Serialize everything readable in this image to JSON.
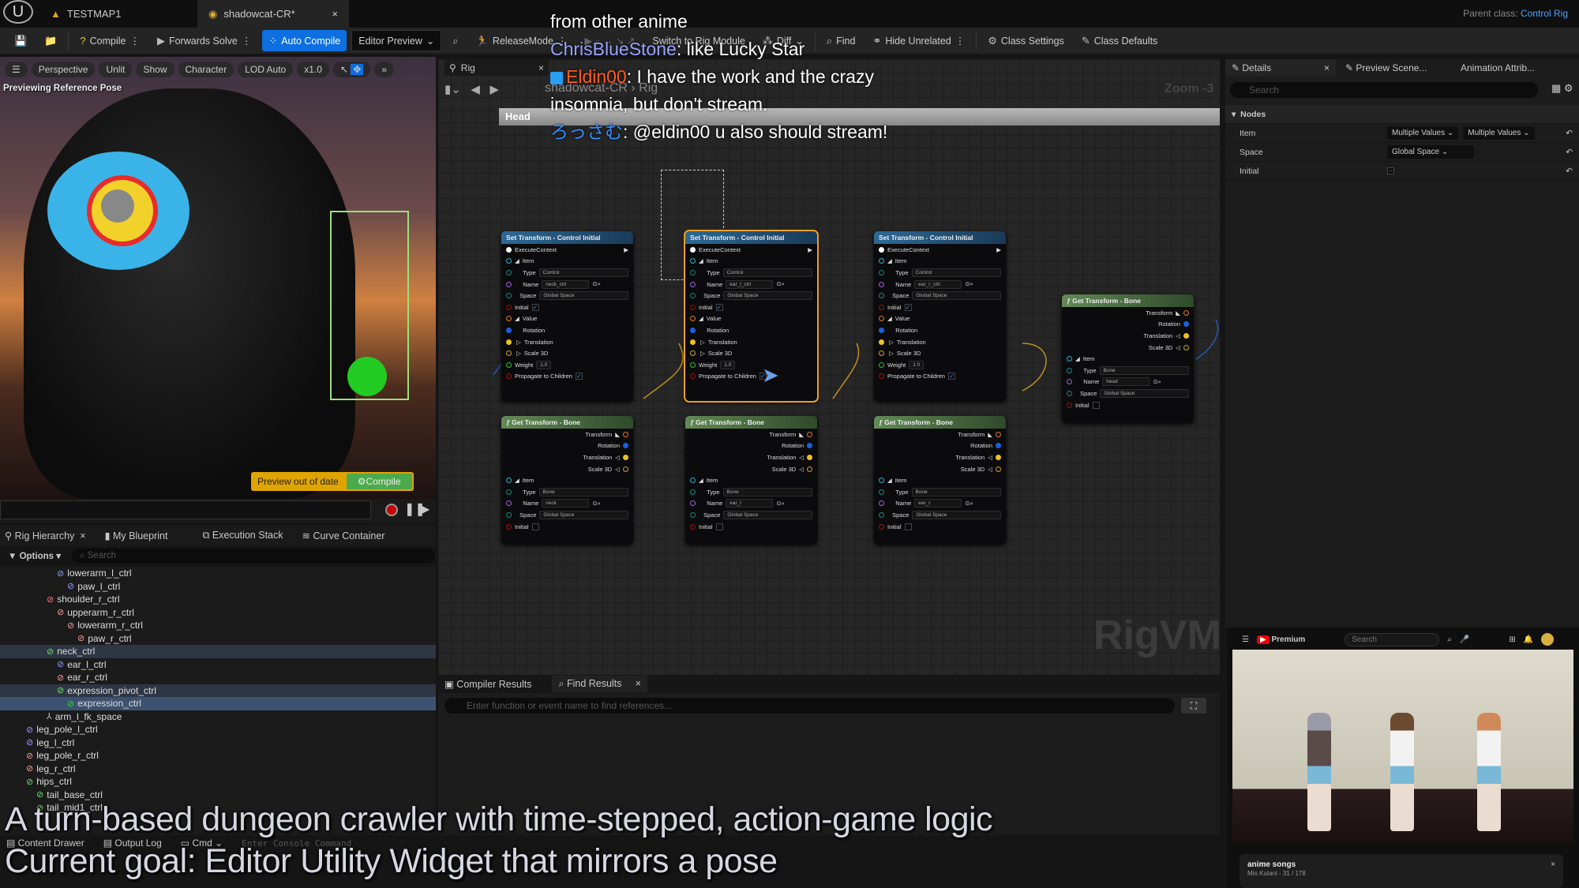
{
  "titlebar": {
    "tabs": [
      {
        "label": "TESTMAP1",
        "icon": "level-icon"
      },
      {
        "label": "shadowcat-CR*",
        "icon": "control-rig-icon"
      }
    ],
    "parent_label": "Parent class:",
    "parent_value": "Control Rig"
  },
  "toolbar": {
    "compile": "Compile",
    "forwards_solve": "Forwards Solve",
    "auto_compile": "Auto Compile",
    "editor_preview": "Editor Preview",
    "release_mode": "ReleaseMode",
    "switch_module": "Switch to Rig Module",
    "diff": "Diff",
    "find": "Find",
    "hide_unrelated": "Hide Unrelated",
    "class_settings": "Class Settings",
    "class_defaults": "Class Defaults"
  },
  "viewport": {
    "buttons": [
      "Perspective",
      "Unlit",
      "Show",
      "Character",
      "LOD Auto",
      "x1.0"
    ],
    "status": "Previewing Reference Pose",
    "preview_out_of_date": "Preview out of date",
    "compile": "Compile"
  },
  "left_panel": {
    "tabs": [
      "Rig Hierarchy",
      "My Blueprint",
      "Execution Stack",
      "Curve Container"
    ],
    "options": "Options",
    "search_placeholder": "Search",
    "tree": [
      {
        "label": "lowerarm_l_ctrl",
        "depth": 4,
        "color": "#9a9aff"
      },
      {
        "label": "paw_l_ctrl",
        "depth": 5,
        "color": "#9a9aff"
      },
      {
        "label": "shoulder_r_ctrl",
        "depth": 3,
        "color": "#ff7a7a"
      },
      {
        "label": "upperarm_r_ctrl",
        "depth": 4,
        "color": "#ff9a9a"
      },
      {
        "label": "lowerarm_r_ctrl",
        "depth": 5,
        "color": "#ff9a9a"
      },
      {
        "label": "paw_r_ctrl",
        "depth": 6,
        "color": "#ff9a9a"
      },
      {
        "label": "neck_ctrl",
        "depth": 3,
        "color": "#6ce06c",
        "sel": 1
      },
      {
        "label": "ear_l_ctrl",
        "depth": 4,
        "color": "#9a9aff"
      },
      {
        "label": "ear_r_ctrl",
        "depth": 4,
        "color": "#ff9a9a"
      },
      {
        "label": "expression_pivot_ctrl",
        "depth": 4,
        "color": "#6ce06c",
        "sel": 1
      },
      {
        "label": "expression_ctrl",
        "depth": 5,
        "color": "#22dd22",
        "sel": 2
      },
      {
        "label": "arm_l_fk_space",
        "depth": 3,
        "color": "#bbb",
        "null": true
      },
      {
        "label": "leg_pole_l_ctrl",
        "depth": 1,
        "color": "#9a9aff"
      },
      {
        "label": "leg_l_ctrl",
        "depth": 1,
        "color": "#9a9aff"
      },
      {
        "label": "leg_pole_r_ctrl",
        "depth": 1,
        "color": "#ff9a9a"
      },
      {
        "label": "leg_r_ctrl",
        "depth": 1,
        "color": "#ff9a9a"
      },
      {
        "label": "hips_ctrl",
        "depth": 1,
        "color": "#6ce06c"
      },
      {
        "label": "tail_base_ctrl",
        "depth": 2,
        "color": "#6ce06c"
      },
      {
        "label": "tail_mid1_ctrl",
        "depth": 2,
        "color": "#6ce06c"
      }
    ]
  },
  "graph": {
    "tab": "Rig",
    "breadcrumb": "shadowcat-CR › Rig",
    "zoom": "Zoom -3",
    "comment": "Head",
    "watermark": "RigVM",
    "set_nodes": [
      {
        "title": "Set Transform - Control Initial",
        "name": "neck_ctrl"
      },
      {
        "title": "Set Transform - Control Initial",
        "name": "ear_l_ctrl",
        "selected": true
      },
      {
        "title": "Set Transform - Control Initial",
        "name": "ear_r_ctrl"
      }
    ],
    "set_fields": {
      "exec": "ExecuteContext",
      "item": "Item",
      "type": "Type",
      "type_value": "Control",
      "name": "Name",
      "space": "Space",
      "space_value": "Global Space",
      "initial": "Initial",
      "value": "Value",
      "rotation": "Rotation",
      "translation": "Translation",
      "scale": "Scale 3D",
      "weight": "Weight",
      "weight_value": "1.0",
      "propagate": "Propagate to Children"
    },
    "get_nodes": [
      {
        "title": "Get Transform - Bone",
        "name": "neck"
      },
      {
        "title": "Get Transform - Bone",
        "name": "ear_l"
      },
      {
        "title": "Get Transform - Bone",
        "name": "ear_r"
      },
      {
        "title": "Get Transform - Bone",
        "name": "head"
      }
    ],
    "get_fields": {
      "transform": "Transform",
      "rotation": "Rotation",
      "translation": "Translation",
      "scale": "Scale 3D",
      "item": "Item",
      "type": "Type",
      "type_value": "Bone",
      "name": "Name",
      "space": "Space",
      "space_value": "Global Space",
      "initial": "Initial"
    }
  },
  "find_panel": {
    "tabs": [
      "Compiler Results",
      "Find Results"
    ],
    "placeholder": "Enter function or event name to find references..."
  },
  "details": {
    "tabs": [
      "Details",
      "Preview Scene...",
      "Animation Attrib..."
    ],
    "search_placeholder": "Search",
    "section": "Nodes",
    "rows": [
      {
        "label": "Item",
        "values": [
          "Multiple Values",
          "Multiple Values"
        ]
      },
      {
        "label": "Space",
        "values": [
          "Global Space"
        ]
      },
      {
        "label": "Initial",
        "values": []
      }
    ]
  },
  "youtube": {
    "brand": "Premium",
    "search_placeholder": "Search",
    "playlist": "anime songs",
    "meta": "Mio Kutani - 31 / 178"
  },
  "statusbar": {
    "content_drawer": "Content Drawer",
    "output_log": "Output Log",
    "cmd": "Cmd",
    "console_placeholder": "Enter Console Command"
  },
  "overlay": {
    "line1": "A turn-based dungeon crawler with time-stepped, action-game logic",
    "line2": "Current goal: Editor Utility Widget that mirrors a pose"
  },
  "chat": [
    {
      "user": "",
      "text": "from other anime"
    },
    {
      "user": "ChrisBlueStone",
      "text": ": like Lucky Star"
    },
    {
      "user": "Eldin00",
      "text": ": I have the work and the crazy insomnia, but don't stream."
    },
    {
      "user": "ろっさむ",
      "text": ": @eldin00 u also should stream!"
    }
  ],
  "colors": {
    "accent": "#0e6fe0",
    "selection": "#f0a020",
    "preview_warning": "#e0a400",
    "compile_green": "#4caa4c"
  }
}
